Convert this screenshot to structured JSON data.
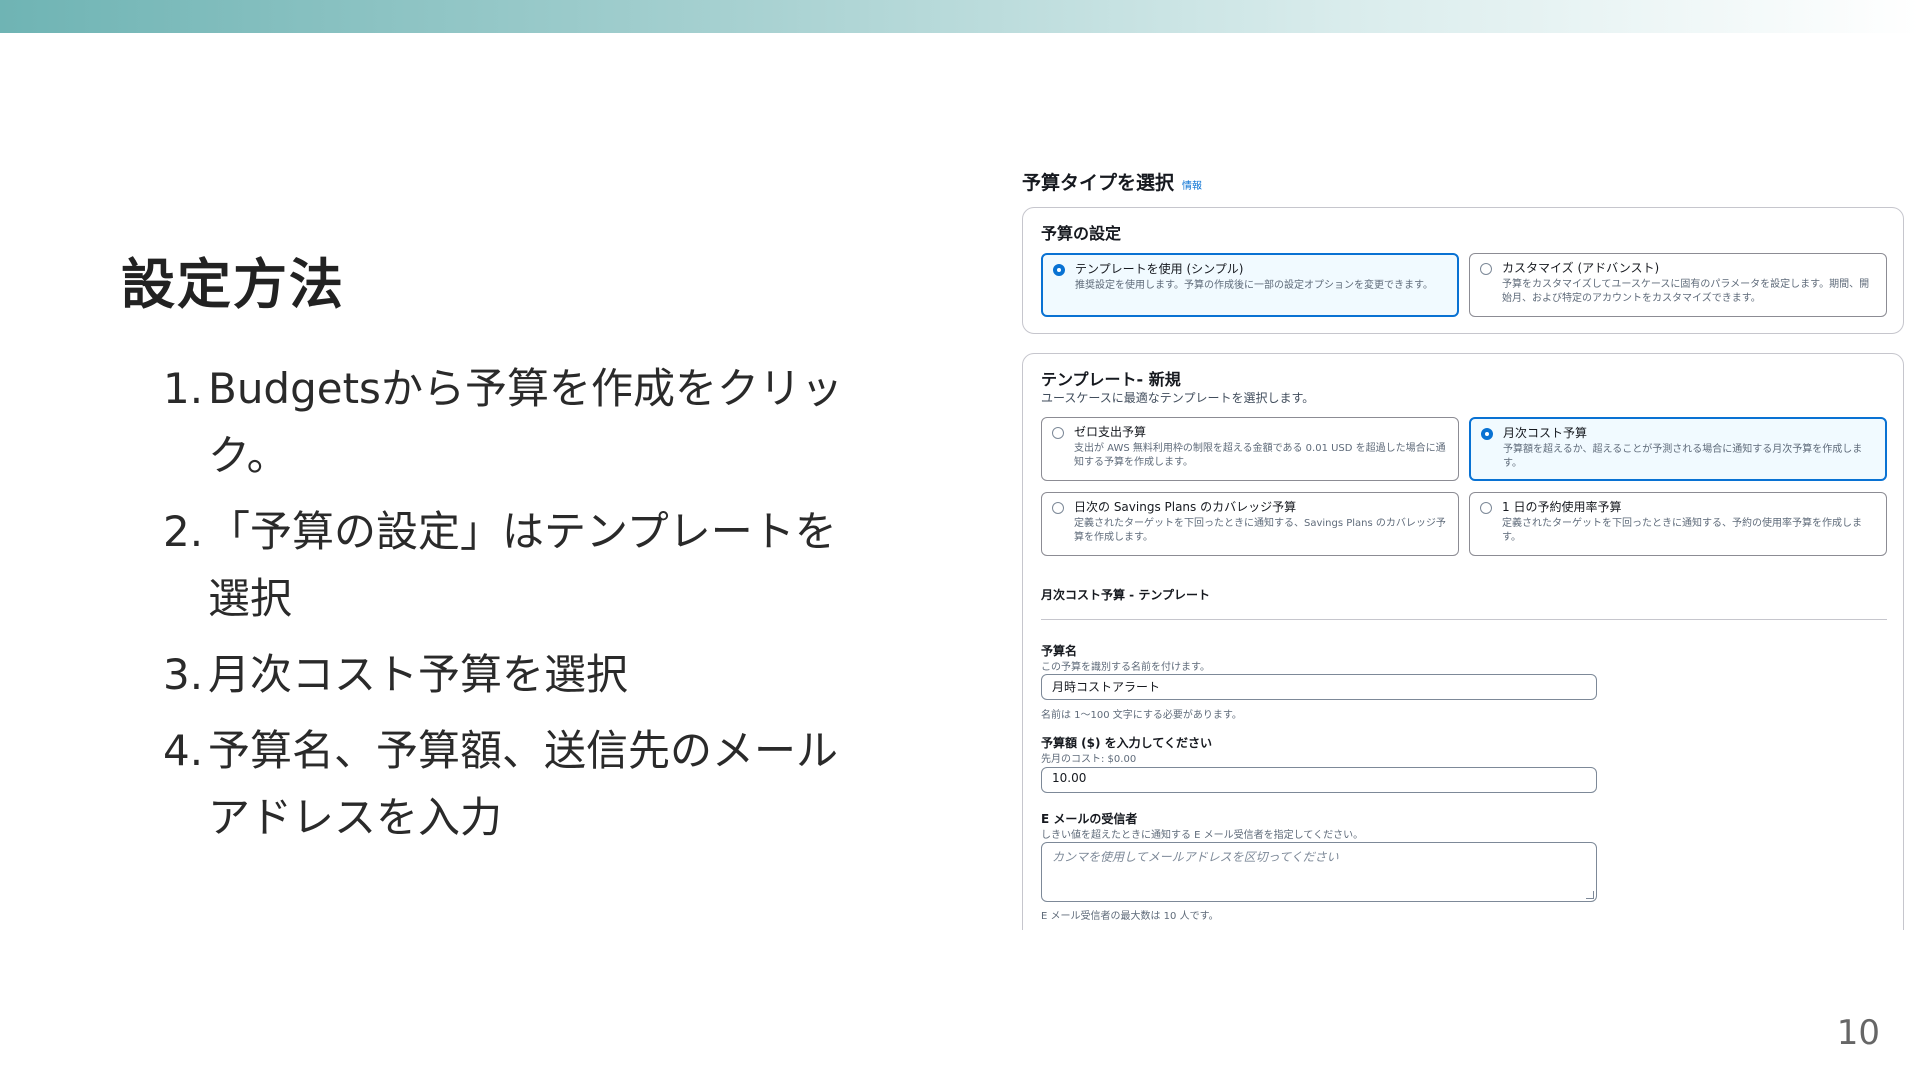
{
  "slide": {
    "title": "設定方法",
    "steps": [
      {
        "num": "1.",
        "text": "Budgetsから予算を作成をクリック。"
      },
      {
        "num": "2.",
        "text": "「予算の設定」はテンプレートを選択"
      },
      {
        "num": "3.",
        "text": "月次コスト予算を選択"
      },
      {
        "num": "4.",
        "text": "予算名、予算額、送信先のメールアドレスを入力"
      }
    ],
    "page_number": "10"
  },
  "screenshot": {
    "heading": "予算タイプを選択",
    "info_link": "情報",
    "budget_setup": {
      "title": "予算の設定",
      "options": [
        {
          "label": "テンプレートを使用 (シンプル)",
          "desc": "推奨設定を使用します。予算の作成後に一部の設定オプションを変更できます。",
          "selected": true
        },
        {
          "label": "カスタマイズ (アドバンスト)",
          "desc": "予算をカスタマイズしてユースケースに固有のパラメータを設定します。期間、開始月、および特定のアカウントをカスタマイズできます。",
          "selected": false
        }
      ]
    },
    "templates": {
      "title": "テンプレート- 新規",
      "desc": "ユースケースに最適なテンプレートを選択します。",
      "options": [
        {
          "label": "ゼロ支出予算",
          "desc": "支出が AWS 無料利用枠の制限を超える金額である 0.01 USD を超過した場合に通知する予算を作成します。",
          "selected": false
        },
        {
          "label": "月次コスト予算",
          "desc": "予算額を超えるか、超えることが予測される場合に通知する月次予算を作成します。",
          "selected": true
        },
        {
          "label": "日次の Savings Plans のカバレッジ予算",
          "desc": "定義されたターゲットを下回ったときに通知する、Savings Plans のカバレッジ予算を作成します。",
          "selected": false
        },
        {
          "label": "1 日の予約使用率予算",
          "desc": "定義されたターゲットを下回ったときに通知する、予約の使用率予算を作成します。",
          "selected": false
        }
      ]
    },
    "monthly_template": {
      "title": "月次コスト予算 - テンプレート",
      "budget_name": {
        "label": "予算名",
        "desc": "この予算を識別する名前を付けます。",
        "value": "月時コストアラート",
        "hint": "名前は 1～100 文字にする必要があります。"
      },
      "budget_amount": {
        "label": "予算額 ($) を入力してください",
        "desc": "先月のコスト: $0.00",
        "value": "10.00"
      },
      "email": {
        "label": "E メールの受信者",
        "desc": "しきい値を超えたときに通知する E メール受信者を指定してください。",
        "placeholder": "カンマを使用してメールアドレスを区切ってください",
        "hint": "E メール受信者の最大数は 10 人です。"
      }
    }
  }
}
